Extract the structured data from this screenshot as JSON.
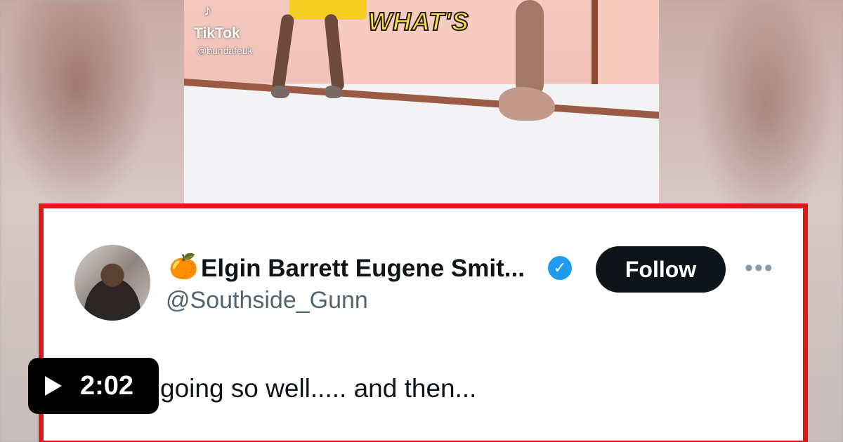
{
  "video": {
    "caption": "WHAT'S",
    "watermark_brand": "TikTok",
    "watermark_user": "@bundafeuk"
  },
  "tweet": {
    "emoji": "🍊",
    "display_name": "Elgin Barrett Eugene Smit...",
    "verified_icon": "verified-badge-icon",
    "handle": "@Southside_Gunn",
    "follow_label": "Follow",
    "more_icon": "more-options-icon",
    "text": "going so well..... and then...",
    "border_color": "#e01818",
    "verified_color": "#1d9bf0"
  },
  "player": {
    "play_icon": "play-icon",
    "duration": "2:02"
  }
}
